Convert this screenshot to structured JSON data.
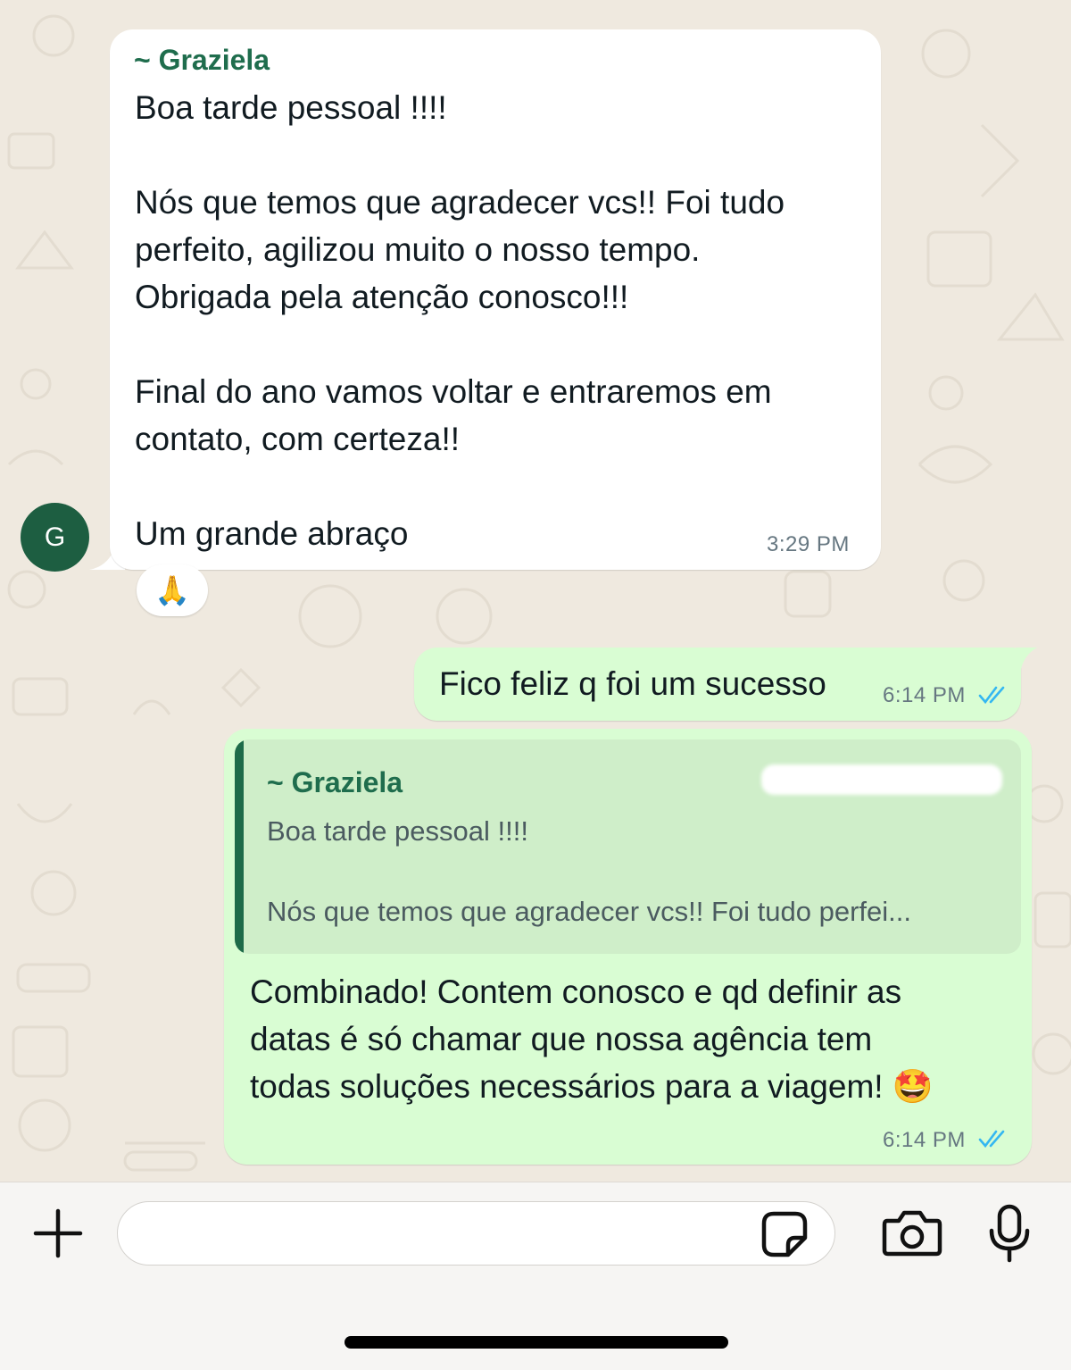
{
  "colors": {
    "incoming_bubble": "#ffffff",
    "outgoing_bubble": "#d9fdd3",
    "sender_name": "#1f6d4d",
    "avatar_bg": "#1d5e41",
    "read_ticks": "#34b7f1",
    "chat_background": "#efe9df"
  },
  "messages": [
    {
      "direction": "incoming",
      "sender": "~ Graziela",
      "lines": [
        "Boa tarde pessoal !!!!",
        "",
        "Nós que temos que agradecer vcs!! Foi tudo",
        "perfeito, agilizou muito o nosso tempo.",
        "Obrigada pela atenção conosco!!!",
        "",
        "Final do ano vamos voltar e entraremos em",
        "contato, com certeza!!",
        "",
        "Um grande abraço"
      ],
      "time": "3:29 PM",
      "reaction": "🙏"
    },
    {
      "direction": "outgoing",
      "text": "Fico feliz q foi um sucesso",
      "time": "6:14 PM",
      "status": "read"
    },
    {
      "direction": "outgoing",
      "quote": {
        "sender": "~ Graziela",
        "line1": "Boa tarde pessoal !!!!",
        "line2": "Nós que temos que agradecer vcs!! Foi tudo perfei..."
      },
      "lines": [
        "Combinado! Contem conosco e qd definir as",
        "datas é só chamar que nossa agência tem",
        "todas soluções necessários para a viagem! 🤩"
      ],
      "time": "6:14 PM",
      "status": "read"
    }
  ],
  "avatar": {
    "initial": "G"
  },
  "input": {
    "placeholder": ""
  },
  "icons": [
    "plus-icon",
    "sticker-icon",
    "camera-icon",
    "microphone-icon",
    "double-check-icon",
    "folded-hands-emoji"
  ]
}
